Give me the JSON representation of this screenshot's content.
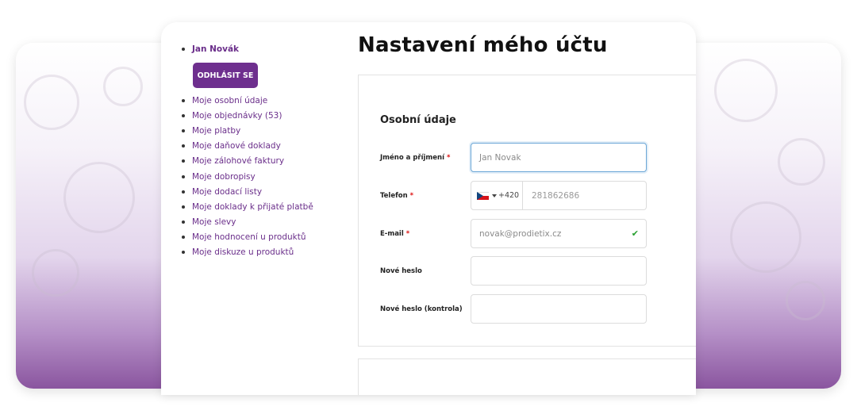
{
  "sidebar": {
    "user_name": "Jan Novák",
    "logout_label": "ODHLÁSIT SE",
    "items": [
      {
        "label": "Moje osobní údaje"
      },
      {
        "label": "Moje objednávky (53)"
      },
      {
        "label": "Moje platby"
      },
      {
        "label": "Moje daňové doklady"
      },
      {
        "label": "Moje zálohové faktury"
      },
      {
        "label": "Moje dobropisy"
      },
      {
        "label": "Moje dodací listy"
      },
      {
        "label": "Moje doklady k přijaté platbě"
      },
      {
        "label": "Moje slevy"
      },
      {
        "label": "Moje hodnocení u produktů"
      },
      {
        "label": "Moje diskuze u produktů"
      }
    ]
  },
  "main": {
    "title": "Nastavení mého účtu",
    "section_title": "Osobní údaje",
    "fields": {
      "name": {
        "label": "Jméno a příjmení",
        "required": "*",
        "value": "Jan Novak"
      },
      "phone": {
        "label": "Telefon",
        "required": "*",
        "prefix": "+420",
        "value": "281862686"
      },
      "email": {
        "label": "E-mail",
        "required": "*",
        "value": "novak@prodietix.cz"
      },
      "new_password": {
        "label": "Nové heslo",
        "value": ""
      },
      "new_password_confirm": {
        "label": "Nové heslo (kontrola)",
        "value": ""
      }
    }
  },
  "colors": {
    "accent": "#6e2f8e",
    "link": "#6a2e8a",
    "required": "#dd1111",
    "focus": "#6aa6d6",
    "valid": "#27a030"
  },
  "icons": {
    "flag": "czech-flag-icon",
    "dropdown": "chevron-down-icon",
    "valid": "checkmark-icon"
  }
}
